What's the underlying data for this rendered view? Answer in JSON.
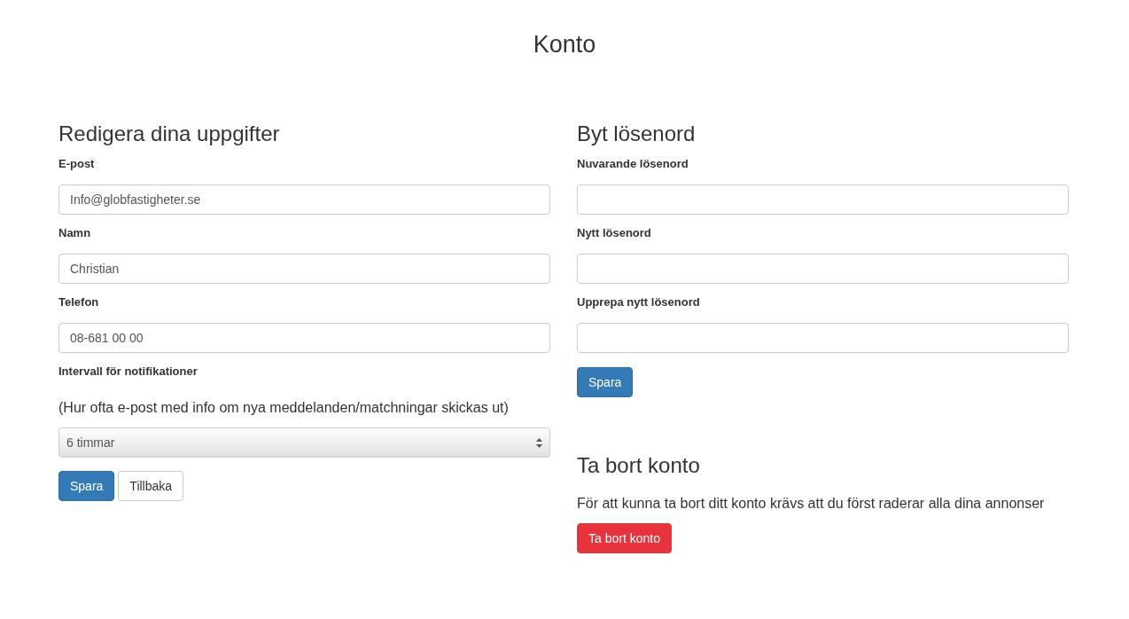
{
  "title": "Konto",
  "profile": {
    "heading": "Redigera dina uppgifter",
    "fields": [
      {
        "label": "E-post",
        "value": "Info@globfastigheter.se"
      },
      {
        "label": "Namn",
        "value": "Christian"
      },
      {
        "label": "Telefon",
        "value": "08-681 00 00"
      }
    ],
    "interval": {
      "label": "Intervall för notifikationer",
      "help": "(Hur ofta e-post med info om nya meddelanden/matchningar skickas ut)",
      "value": "6 timmar"
    },
    "buttons": [
      {
        "label": "Spara",
        "kind": "primary"
      },
      {
        "label": "Tillbaka",
        "kind": "default"
      }
    ]
  },
  "password": {
    "heading": "Byt lösenord",
    "fields": [
      {
        "label": "Nuvarande lösenord"
      },
      {
        "label": "Nytt lösenord"
      },
      {
        "label": "Upprepa nytt lösenord"
      }
    ],
    "button": "Spara"
  },
  "delete": {
    "heading": "Ta bort konto",
    "text": "För att kunna ta bort ditt konto krävs att du först raderar alla dina annonser",
    "button": "Ta bort konto"
  }
}
